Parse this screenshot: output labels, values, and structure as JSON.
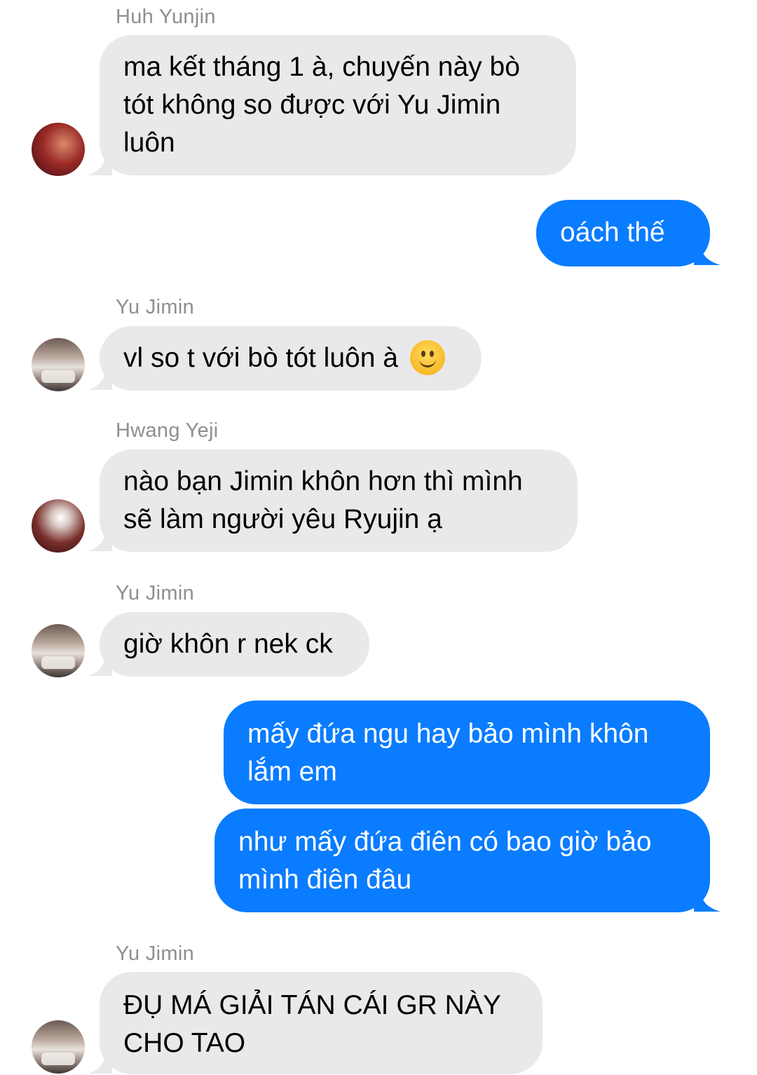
{
  "messages": [
    {
      "sender": "Huh Yunjin",
      "text": "ma kết tháng 1 à, chuyến này bò\ntót không so được với Yu Jimin\nluôn",
      "direction": "incoming"
    },
    {
      "text": "oách thế",
      "direction": "outgoing"
    },
    {
      "sender": "Yu Jimin",
      "text": "vl so t với bò tót luôn à",
      "emoji": "slightly-smiling-face",
      "direction": "incoming"
    },
    {
      "sender": "Hwang Yeji",
      "text": "nào bạn Jimin khôn hơn thì mình\nsẽ làm người yêu Ryujin ạ",
      "direction": "incoming"
    },
    {
      "sender": "Yu Jimin",
      "text": "giờ khôn r nek ck",
      "direction": "incoming"
    },
    {
      "text": "mấy đứa ngu hay bảo mình khôn\nlắm em",
      "direction": "outgoing"
    },
    {
      "text": "như mấy đứa điên có bao giờ bảo\nmình điên đâu",
      "direction": "outgoing"
    },
    {
      "sender": "Yu Jimin",
      "text": "ĐỤ MÁ GIẢI TÁN CÁI GR NÀY\nCHO TAO",
      "direction": "incoming"
    }
  ],
  "colors": {
    "incoming_bubble": "#e9e9eb",
    "outgoing_bubble": "#0a7cff",
    "sender_name": "#8e8e93"
  }
}
